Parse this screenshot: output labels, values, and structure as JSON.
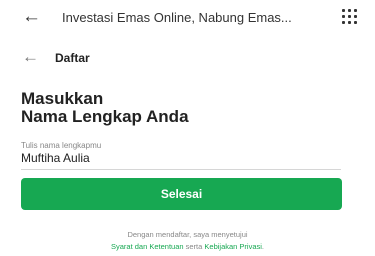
{
  "browser": {
    "back_icon": "arrow-left-icon",
    "title": "Investasi Emas Online, Nabung Emas...",
    "menu_icon": "grid-menu-icon"
  },
  "header": {
    "back_icon": "arrow-left-icon",
    "title": "Daftar"
  },
  "form": {
    "heading_line1": "Masukkan",
    "heading_line2": "Nama Lengkap Anda",
    "name_label": "Tulis nama lengkapmu",
    "name_value": "Muftiha Aulia",
    "submit_label": "Selesai"
  },
  "footer": {
    "text_line1": "Dengan mendaftar, saya menyetujui",
    "terms_link": "Syarat dan Ketentuan",
    "connector": " serta ",
    "privacy_link": "Kebijakan Privasi",
    "end": "."
  },
  "colors": {
    "primary_green": "#17a852",
    "muted_text": "#888888"
  }
}
